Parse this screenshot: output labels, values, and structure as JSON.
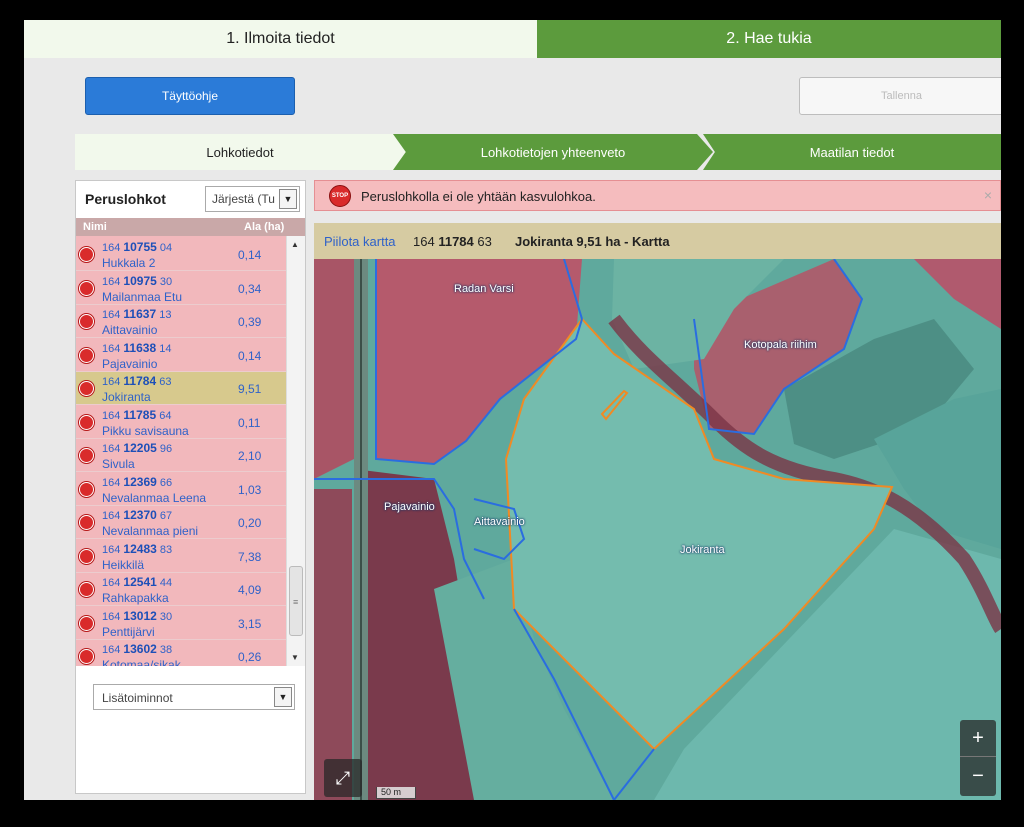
{
  "steps": {
    "step1": "1. Ilmoita tiedot",
    "step2": "2. Hae tukia"
  },
  "toolbar": {
    "help_label": "Täyttöohje",
    "save_label": "Tallenna"
  },
  "subtabs": [
    "Lohkotiedot",
    "Lohkotietojen yhteenveto",
    "Maatilan tiedot"
  ],
  "left_panel": {
    "title": "Peruslohkot",
    "sort_value": "Järjestä (Tu",
    "col_name": "Nimi",
    "col_area": "Ala (ha)",
    "rows": [
      {
        "prefix": "164",
        "num": "10755",
        "suffix": "04",
        "name": "Hukkala 2",
        "area": "0,14"
      },
      {
        "prefix": "164",
        "num": "10975",
        "suffix": "30",
        "name": "Mailanmaa Etu",
        "area": "0,34"
      },
      {
        "prefix": "164",
        "num": "11637",
        "suffix": "13",
        "name": "Aittavainio",
        "area": "0,39"
      },
      {
        "prefix": "164",
        "num": "11638",
        "suffix": "14",
        "name": "Pajavainio",
        "area": "0,14"
      },
      {
        "prefix": "164",
        "num": "11784",
        "suffix": "63",
        "name": "Jokiranta",
        "area": "9,51"
      },
      {
        "prefix": "164",
        "num": "11785",
        "suffix": "64",
        "name": "Pikku savisauna",
        "area": "0,11"
      },
      {
        "prefix": "164",
        "num": "12205",
        "suffix": "96",
        "name": "Sivula",
        "area": "2,10"
      },
      {
        "prefix": "164",
        "num": "12369",
        "suffix": "66",
        "name": "Nevalanmaa Leena",
        "area": "1,03"
      },
      {
        "prefix": "164",
        "num": "12370",
        "suffix": "67",
        "name": "Nevalanmaa pieni",
        "area": "0,20"
      },
      {
        "prefix": "164",
        "num": "12483",
        "suffix": "83",
        "name": "Heikkilä",
        "area": "7,38"
      },
      {
        "prefix": "164",
        "num": "12541",
        "suffix": "44",
        "name": "Rahkapakka",
        "area": "4,09"
      },
      {
        "prefix": "164",
        "num": "13012",
        "suffix": "30",
        "name": "Penttijärvi",
        "area": "3,15"
      },
      {
        "prefix": "164",
        "num": "13602",
        "suffix": "38",
        "name": "Kotomaa/sikak",
        "area": "0,26"
      }
    ],
    "selected_index": 4,
    "more_value": "Lisätoiminnot"
  },
  "alert": {
    "message": "Peruslohkolla ei ole yhtään kasvulohkoa.",
    "close": "×",
    "icon": "STOP"
  },
  "map_header": {
    "hide_link": "Piilota kartta",
    "code_prefix": "164",
    "code_num": "11784",
    "code_suffix": "63",
    "title": "Jokiranta 9,51 ha - Kartta"
  },
  "map": {
    "labels": [
      "Radan Varsi",
      "Kotopala riihim",
      "Pajavainio",
      "Aittavainio",
      "Jokiranta"
    ],
    "zoom_in": "+",
    "zoom_out": "−",
    "scale": "50 m"
  },
  "colors": {
    "accent_blue": "#2b7bd8",
    "step_green": "#5c9b3d",
    "row_pink": "#f2b8bc",
    "row_selected": "#d7c98d",
    "parcel_orange": "#f08a24",
    "parcel_blue": "#2a6de0"
  }
}
